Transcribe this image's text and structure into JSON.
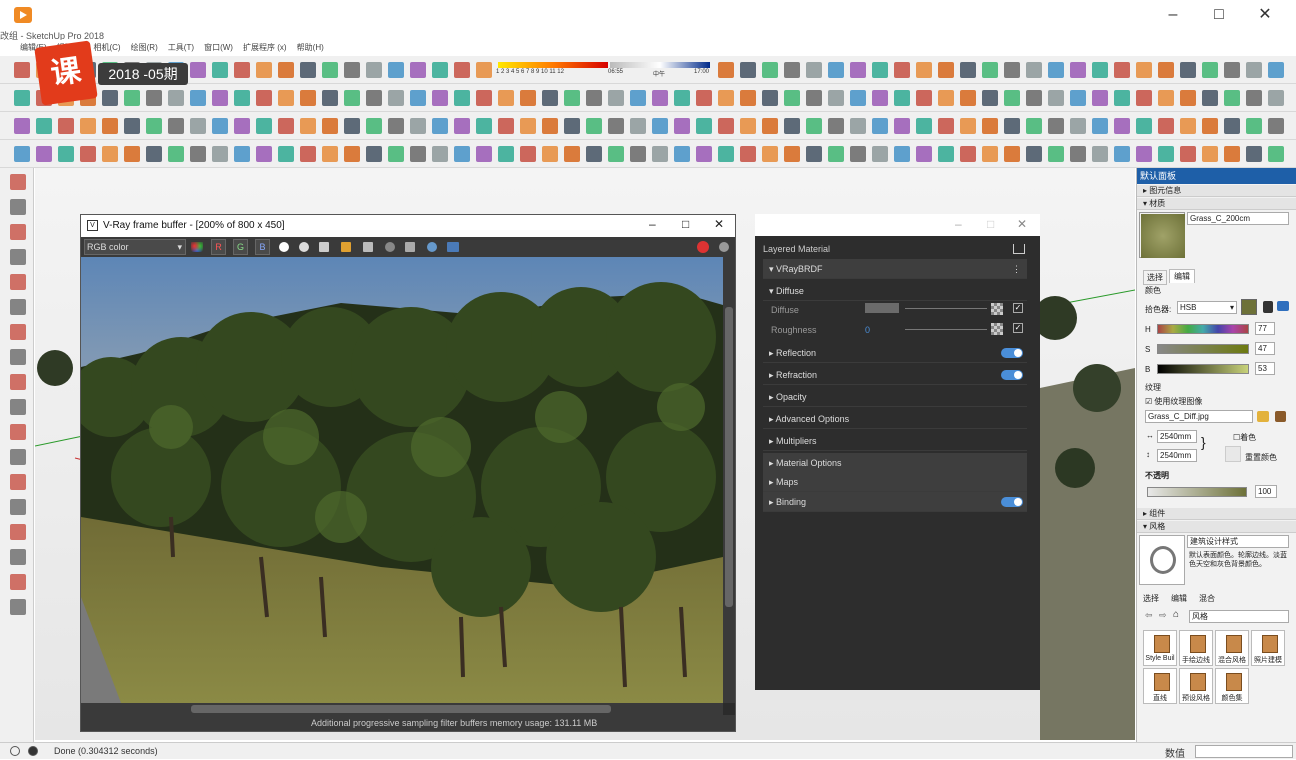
{
  "window": {
    "title": "SketchUp Pro 2018",
    "title_prefix": "改组"
  },
  "menu": [
    "编辑(E)",
    "视图(V)",
    "相机(C)",
    "绘图(R)",
    "工具(T)",
    "窗口(W)",
    "扩展程序 (x)",
    "帮助(H)"
  ],
  "badge": {
    "logo_text": "课",
    "episode": "2018 -05期"
  },
  "sun_ticks": "1 2 3 4 5 6 7 8 9 10 11 12",
  "time_start": "06:55",
  "time_mid": "中午",
  "time_end": "17:00",
  "status": {
    "text": "Done (0.304312 seconds)",
    "measure_label": "数值"
  },
  "vfb": {
    "title": "V-Ray frame buffer - [200% of 800 x 450]",
    "channel": "RGB color",
    "r": "R",
    "g": "G",
    "b": "B",
    "status": "Additional progressive sampling filter buffers memory usage: 131.11 MB"
  },
  "material": {
    "header": "Layered Material",
    "brdf": "VRayBRDF",
    "diffuse_section": "Diffuse",
    "diffuse_label": "Diffuse",
    "roughness_label": "Roughness",
    "roughness_value": "0",
    "sections": [
      "Reflection",
      "Refraction",
      "Opacity",
      "Advanced Options",
      "Multipliers",
      "Material Options",
      "Maps",
      "Binding"
    ]
  },
  "tray": {
    "title": "默认面板",
    "entity_info": "图元信息",
    "materials": "材质",
    "material_name": "Grass_C_200cm",
    "tab_select": "选择",
    "tab_edit": "编辑",
    "color_label": "颜色",
    "picker_label": "拾色器:",
    "picker_mode": "HSB",
    "h_label": "H",
    "h_value": "77",
    "s_label": "S",
    "s_value": "47",
    "b_label": "B",
    "b_value": "53",
    "texture_label": "纹理",
    "use_texture": "使用纹理图像",
    "texture_file": "Grass_C_Diff.jpg",
    "width": "2540mm",
    "height": "2540mm",
    "colorize": "着色",
    "reset_color": "重置颜色",
    "opacity_label": "不透明",
    "opacity_value": "100",
    "components": "组件",
    "styles": "风格",
    "style_name": "建筑设计样式",
    "style_desc": "默认表面颜色。轮廓边线。淡蓝色天空和灰色背景颜色。",
    "styles_tab_select": "选择",
    "styles_tab_edit": "编辑",
    "styles_tab_mix": "混合",
    "styles_dropdown": "风格",
    "tiles": [
      "Style Buil",
      "手绘边线",
      "混合风格",
      "照片建模",
      "直线",
      "预设风格",
      "颜色集"
    ]
  },
  "colors": {
    "accent": "#1e5fa8",
    "vray_bg": "#2d2d2d",
    "toggle": "#4a8ed8",
    "swatch": "#6d7138"
  }
}
